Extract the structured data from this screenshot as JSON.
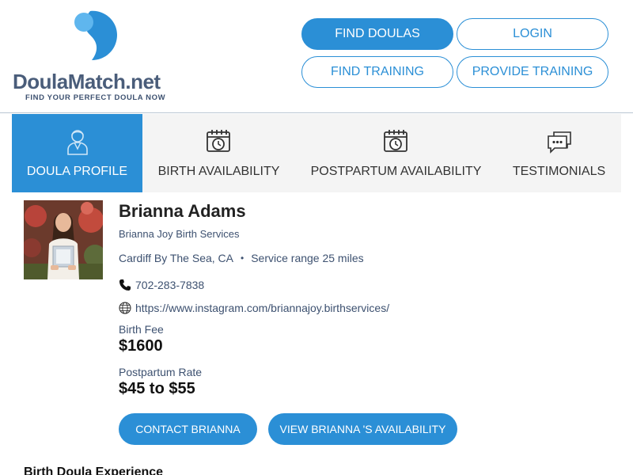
{
  "header": {
    "logo": {
      "brand_doula": "DoulaMatch",
      "brand_net": ".net",
      "tagline": "FIND YOUR PERFECT DOULA NOW"
    },
    "nav": {
      "find_doulas": "FIND DOULAS",
      "login": "LOGIN",
      "find_training": "FIND TRAINING",
      "provide_training": "PROVIDE TRAINING"
    }
  },
  "tabs": [
    {
      "label": "DOULA PROFILE",
      "icon": "doula-person-icon",
      "active": true
    },
    {
      "label": "BIRTH AVAILABILITY",
      "icon": "calendar-clock-icon",
      "active": false
    },
    {
      "label": "POSTPARTUM AVAILABILITY",
      "icon": "calendar-clock-icon",
      "active": false
    },
    {
      "label": "TESTIMONIALS",
      "icon": "chat-bubbles-icon",
      "active": false
    }
  ],
  "profile": {
    "name": "Brianna Adams",
    "business": "Brianna Joy Birth Services",
    "location": "Cardiff By The Sea, CA",
    "separator": "•",
    "service_range": "Service range 25 miles",
    "phone": "702-283-7838",
    "website": "https://www.instagram.com/briannajoy.birthservices/",
    "birth_fee_label": "Birth Fee",
    "birth_fee": "$1600",
    "postpartum_label": "Postpartum Rate",
    "postpartum_rate": "$45 to $55",
    "contact_button": "CONTACT BRIANNA",
    "availability_button": "VIEW BRIANNA 'S AVAILABILITY"
  },
  "sections": {
    "experience_title": "Birth Doula Experience"
  },
  "colors": {
    "accent": "#2b8fd6",
    "text_muted": "#3d5170",
    "tab_bg": "#f4f4f4"
  }
}
